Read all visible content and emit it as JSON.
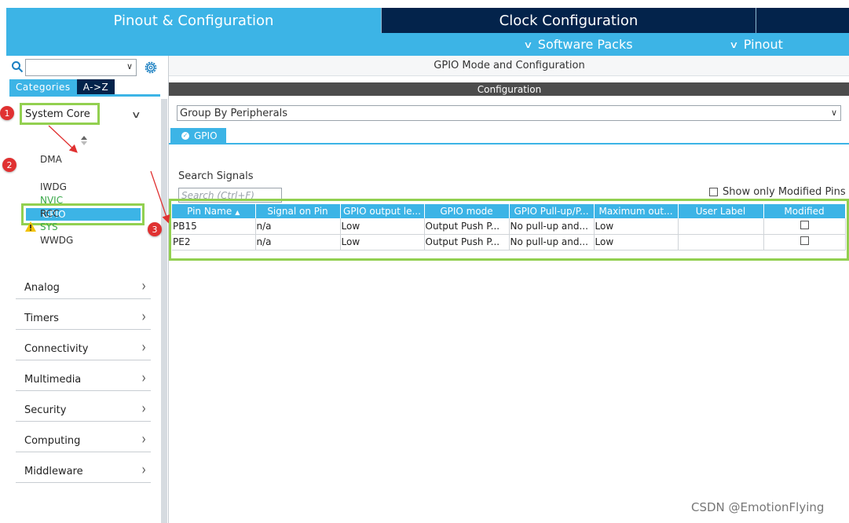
{
  "top_tabs": {
    "pinout": "Pinout & Configuration",
    "clock": "Clock Configuration"
  },
  "sub_menu": {
    "software_packs": "Software Packs",
    "pinout": "Pinout"
  },
  "left_panel": {
    "search_value": "",
    "tabs": {
      "categories": "Categories",
      "a_to_z": "A->Z"
    },
    "system_core": "System Core",
    "peripherals": {
      "dma": "DMA",
      "gpio": "GPIO",
      "iwdg": "IWDG",
      "nvic": "NVIC",
      "rcc": "RCC",
      "sys": "SYS",
      "wwdg": "WWDG"
    },
    "categories": {
      "analog": "Analog",
      "timers": "Timers",
      "connectivity": "Connectivity",
      "multimedia": "Multimedia",
      "security": "Security",
      "computing": "Computing",
      "middleware": "Middleware"
    }
  },
  "main": {
    "mode_title": "GPIO Mode and Configuration",
    "config_title": "Configuration",
    "group_by": "Group By Peripherals",
    "gpio_tab": "GPIO",
    "search_signals_label": "Search Signals",
    "search_placeholder": "Search (Ctrl+F)",
    "show_modified": "Show only Modified Pins",
    "table": {
      "headers": {
        "pin_name": "Pin Name",
        "signal": "Signal on Pin",
        "output_level": "GPIO output le...",
        "mode": "GPIO mode",
        "pull": "GPIO Pull-up/P...",
        "max_output": "Maximum out...",
        "user_label": "User Label",
        "modified": "Modified"
      },
      "rows": [
        {
          "pin": "PB15",
          "signal": "n/a",
          "level": "Low",
          "mode": "Output Push P...",
          "pull": "No pull-up and...",
          "speed": "Low",
          "label": ""
        },
        {
          "pin": "PE2",
          "signal": "n/a",
          "level": "Low",
          "mode": "Output Push P...",
          "pull": "No pull-up and...",
          "speed": "Low",
          "label": ""
        }
      ]
    }
  },
  "annotations": {
    "m1": "1",
    "m2": "2",
    "m3": "3"
  },
  "watermark": "CSDN @EmotionFlying",
  "colors": {
    "accent": "#3cb4e6",
    "dark": "#03234b",
    "highlight": "#92d050",
    "marker": "#e03131"
  }
}
